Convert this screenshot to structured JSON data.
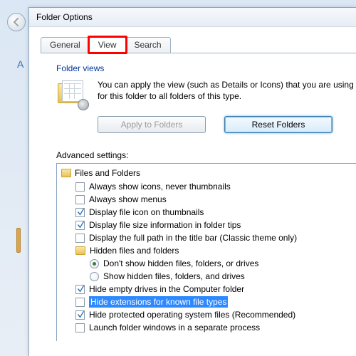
{
  "stray_letter": "A",
  "dialog": {
    "title": "Folder Options",
    "tabs": [
      {
        "label": "General",
        "active": false
      },
      {
        "label": "View",
        "active": true,
        "redbox": true
      },
      {
        "label": "Search",
        "active": false
      }
    ],
    "folder_views": {
      "heading": "Folder views",
      "description": "You can apply the view (such as Details or Icons) that you are using for this folder to all folders of this type.",
      "apply_btn": "Apply to Folders",
      "reset_btn": "Reset Folders"
    },
    "advanced": {
      "label": "Advanced settings:",
      "root": "Files and Folders",
      "items": [
        {
          "type": "check",
          "checked": false,
          "label": "Always show icons, never thumbnails"
        },
        {
          "type": "check",
          "checked": false,
          "label": "Always show menus"
        },
        {
          "type": "check",
          "checked": true,
          "label": "Display file icon on thumbnails"
        },
        {
          "type": "check",
          "checked": true,
          "label": "Display file size information in folder tips"
        },
        {
          "type": "check",
          "checked": false,
          "label": "Display the full path in the title bar (Classic theme only)"
        },
        {
          "type": "folder",
          "label": "Hidden files and folders"
        },
        {
          "type": "radio",
          "checked": true,
          "label": "Don't show hidden files, folders, or drives",
          "indent": 2
        },
        {
          "type": "radio",
          "checked": false,
          "label": "Show hidden files, folders, and drives",
          "indent": 2
        },
        {
          "type": "check",
          "checked": true,
          "label": "Hide empty drives in the Computer folder"
        },
        {
          "type": "check",
          "checked": false,
          "label": "Hide extensions for known file types",
          "highlight": true
        },
        {
          "type": "check",
          "checked": true,
          "label": "Hide protected operating system files (Recommended)"
        },
        {
          "type": "check",
          "checked": false,
          "label": "Launch folder windows in a separate process"
        }
      ]
    }
  }
}
